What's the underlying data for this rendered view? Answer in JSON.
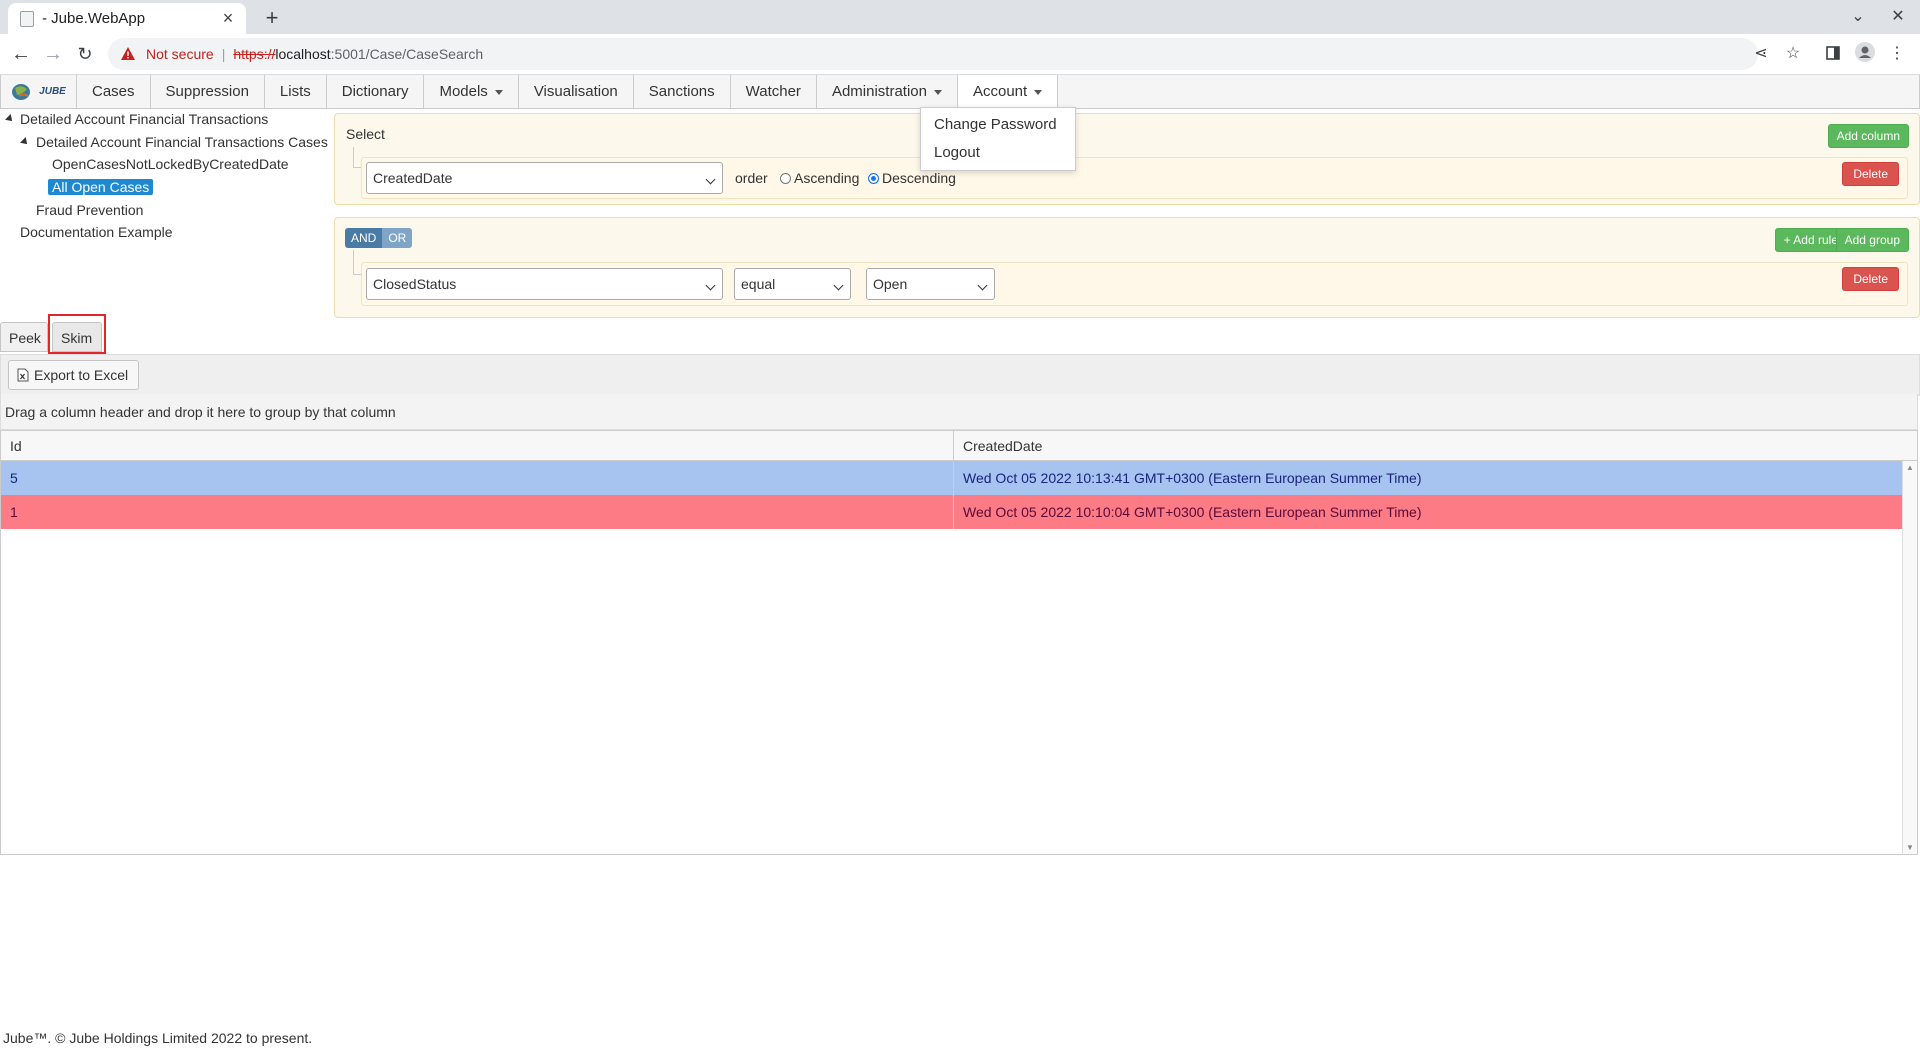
{
  "browser": {
    "tab_title": "- Jube.WebApp",
    "not_secure": "Not secure",
    "url_scheme": "https://",
    "url_host": "localhost",
    "url_path": ":5001/Case/CaseSearch"
  },
  "nav": {
    "logo_text": "JUBE",
    "items": [
      {
        "label": "Cases",
        "dropdown": false
      },
      {
        "label": "Suppression",
        "dropdown": false
      },
      {
        "label": "Lists",
        "dropdown": false
      },
      {
        "label": "Dictionary",
        "dropdown": false
      },
      {
        "label": "Models",
        "dropdown": true
      },
      {
        "label": "Visualisation",
        "dropdown": false
      },
      {
        "label": "Sanctions",
        "dropdown": false
      },
      {
        "label": "Watcher",
        "dropdown": false
      },
      {
        "label": "Administration",
        "dropdown": true
      },
      {
        "label": "Account",
        "dropdown": true
      }
    ],
    "account_menu": [
      "Change Password",
      "Logout"
    ]
  },
  "tree": {
    "root": "Detailed Account Financial Transactions",
    "child": "Detailed Account Financial Transactions Cases",
    "leaf1": "OpenCasesNotLockedByCreatedDate",
    "leaf2_selected": "All Open Cases",
    "sibling1": "Fraud Prevention",
    "sibling2": "Documentation Example"
  },
  "select_group": {
    "title": "Select",
    "add_column": "Add column",
    "delete": "Delete",
    "column_value": "CreatedDate",
    "order_label": "order",
    "ascending": "Ascending",
    "descending": "Descending",
    "selected_order": "Descending"
  },
  "filter_group": {
    "and_label": "AND",
    "or_label": "OR",
    "add_rule": "+ Add rule",
    "add_group": "Add group",
    "delete": "Delete",
    "field_value": "ClosedStatus",
    "operator_value": "equal",
    "value_value": "Open"
  },
  "tabs": {
    "peek": "Peek",
    "skim": "Skim"
  },
  "grid": {
    "export_label": "Export to Excel",
    "group_hint": "Drag a column header and drop it here to group by that column",
    "columns": [
      "Id",
      "CreatedDate"
    ],
    "rows": [
      {
        "id": "5",
        "created": "Wed Oct 05 2022 10:13:41 GMT+0300 (Eastern European Summer Time)",
        "color": "#a6c4ef"
      },
      {
        "id": "1",
        "created": "Wed Oct 05 2022 10:10:04 GMT+0300 (Eastern European Summer Time)",
        "color": "#fc7b85"
      }
    ]
  },
  "footer": "Jube™. © Jube Holdings Limited 2022 to present."
}
